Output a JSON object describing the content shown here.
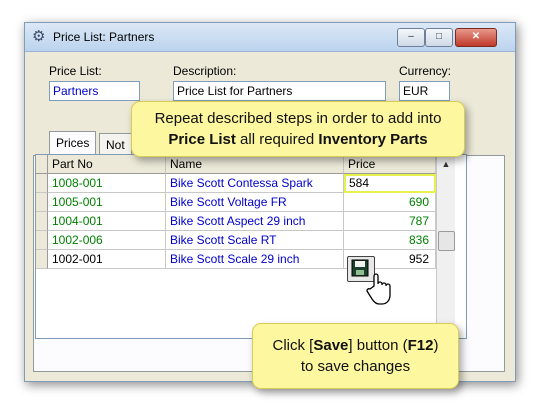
{
  "window": {
    "title": "Price List: Partners",
    "min": "–",
    "max": "□",
    "close": "✕"
  },
  "form": {
    "price_list_label": "Price List:",
    "price_list_value": "Partners",
    "description_label": "Description:",
    "description_value": "Price List for Partners",
    "currency_label": "Currency:",
    "currency_value": "EUR"
  },
  "tabs": [
    {
      "label": "Prices"
    },
    {
      "label": "Not"
    }
  ],
  "grid": {
    "columns": [
      "Part No",
      "Name",
      "Price"
    ],
    "rows": [
      {
        "part_no": "1008-001",
        "name": "Bike Scott Contessa Spark",
        "price": "584",
        "editing": true
      },
      {
        "part_no": "1005-001",
        "name": "Bike Scott Voltage FR",
        "price": "690"
      },
      {
        "part_no": "1004-001",
        "name": "Bike Scott Aspect 29 inch",
        "price": "787"
      },
      {
        "part_no": "1002-006",
        "name": "Bike Scott Scale RT",
        "price": "836"
      },
      {
        "part_no": "1002-001",
        "name": "Bike Scott Scale 29 inch",
        "price": "952"
      }
    ]
  },
  "callouts": {
    "top": {
      "line1": "Repeat described steps in order to add into",
      "line2a": "Price List",
      "line2b": " all required ",
      "line2c": "Inventory Parts"
    },
    "bottom": {
      "l1a": "Click [",
      "l1b": "Save",
      "l1c": "] button (",
      "l1d": "F12",
      "l1e": ")",
      "line2": "to save changes"
    }
  },
  "colors": {
    "green_text": "#008000",
    "blue_text": "#0000cc",
    "callout_bg": "#fdf7a0",
    "edit_highlight": "#e8f04a"
  },
  "icons": [
    "app-icon",
    "save-icon",
    "hand-cursor-icon",
    "scroll-up-icon"
  ]
}
